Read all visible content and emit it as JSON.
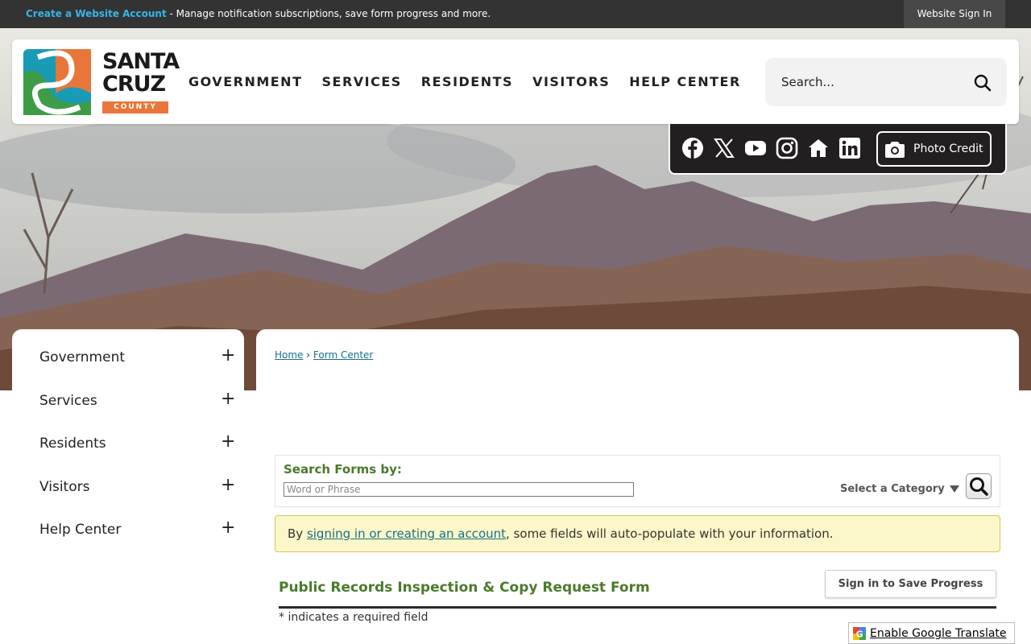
{
  "topbar": {
    "account_link": "Create a Website Account",
    "account_desc": " - Manage notification subscriptions, save form progress and more.",
    "signin": "Website Sign In"
  },
  "logo": {
    "line1": "SANTA",
    "line2": "CRUZ",
    "county": "COUNTY",
    "colors": {
      "teal": "#1a9bb5",
      "orange": "#e8763a",
      "green": "#3e9c47"
    }
  },
  "nav": [
    "GOVERNMENT",
    "SERVICES",
    "RESIDENTS",
    "VISITORS",
    "HELP CENTER"
  ],
  "search": {
    "placeholder": "Search..."
  },
  "social": {
    "icons": [
      "facebook-icon",
      "x-icon",
      "youtube-icon",
      "instagram-icon",
      "nextdoor-icon",
      "linkedin-icon"
    ],
    "photo_credit": "Photo Credit"
  },
  "sidebar": {
    "items": [
      {
        "label": "Government",
        "expand": "+"
      },
      {
        "label": "Services",
        "expand": "+"
      },
      {
        "label": "Residents",
        "expand": "+"
      },
      {
        "label": "Visitors",
        "expand": "+"
      },
      {
        "label": "Help Center",
        "expand": "+"
      }
    ]
  },
  "breadcrumb": {
    "home": "Home",
    "sep": "›",
    "current": "Form Center"
  },
  "search_forms": {
    "title": "Search Forms by:",
    "placeholder": "Word or Phrase",
    "category": "Select a Category"
  },
  "notice": {
    "prefix": "By ",
    "link": "signing in or creating an account",
    "suffix": ", some fields will auto-populate with your information."
  },
  "form": {
    "title": "Public Records Inspection & Copy Request Form",
    "save_button": "Sign in to Save Progress",
    "required_note": "* indicates a required field"
  },
  "translate": {
    "label": "Enable Google Translate"
  },
  "colors": {
    "accent_green": "#4a7a2c",
    "link_blue": "#186f8c",
    "topbar": "#333333",
    "notice_bg": "#fcf7c8"
  }
}
